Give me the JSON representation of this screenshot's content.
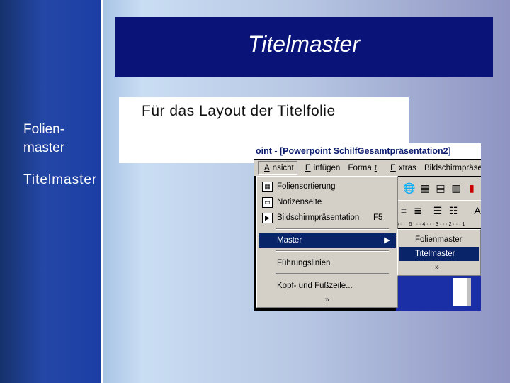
{
  "sidebar": {
    "items": [
      {
        "label": "Folien-\nmaster"
      },
      {
        "label": "Titelmaster"
      }
    ]
  },
  "slide": {
    "title": "Titelmaster",
    "subtitle": "Für das Layout der Titelfolie"
  },
  "screenshot": {
    "window_title": "oint - [Powerpoint SchilfGesamtpräsentation2]",
    "menubar": [
      "Ansicht",
      "Einfügen",
      "Format",
      "Extras",
      "Bildschirmpräsentation"
    ],
    "menu": {
      "items": [
        {
          "label": "Foliensortierung",
          "icon": "slide-sorter-icon"
        },
        {
          "label": "Notizenseite",
          "icon": "notes-page-icon"
        },
        {
          "label": "Bildschirmpräsentation",
          "shortcut": "F5",
          "icon": "slideshow-icon"
        },
        {
          "label": "Master",
          "highlighted": true
        },
        {
          "label": "Führungslinien"
        },
        {
          "label": "Kopf- und Fußzeile..."
        }
      ],
      "expand_glyph": "»"
    },
    "submenu": {
      "items": [
        {
          "label": "Folienmaster"
        },
        {
          "label": "Titelmaster",
          "highlighted": true
        }
      ],
      "expand_glyph": "»"
    }
  },
  "colors": {
    "title_box": "#0a1478",
    "sidebar": "#1b3ea6",
    "menu_highlight": "#0a246a"
  }
}
